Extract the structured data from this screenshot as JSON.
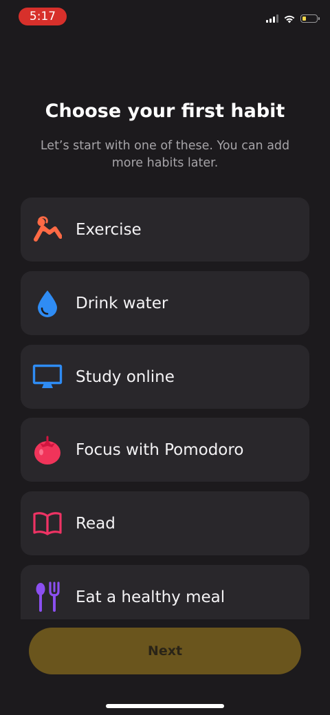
{
  "status_bar": {
    "time": "5:17",
    "icons": [
      "cellular-signal-icon",
      "wifi-icon",
      "battery-icon"
    ]
  },
  "header": {
    "title": "Choose your first habit",
    "subtitle": "Let’s start with one of these. You can add more habits later."
  },
  "habits": [
    {
      "label": "Exercise",
      "icon": "exercise-icon",
      "color": "#ff6a45"
    },
    {
      "label": "Drink water",
      "icon": "water-drop-icon",
      "color": "#2f8cf4"
    },
    {
      "label": "Study online",
      "icon": "monitor-icon",
      "color": "#2f8cf4"
    },
    {
      "label": "Focus with Pomodoro",
      "icon": "tomato-icon",
      "color": "#f0345a"
    },
    {
      "label": "Read",
      "icon": "book-icon",
      "color": "#ee3364"
    },
    {
      "label": "Eat a healthy meal",
      "icon": "utensils-icon",
      "color": "#8b4ff0"
    }
  ],
  "footer": {
    "next_label": "Next",
    "next_color": "#6a551d"
  }
}
